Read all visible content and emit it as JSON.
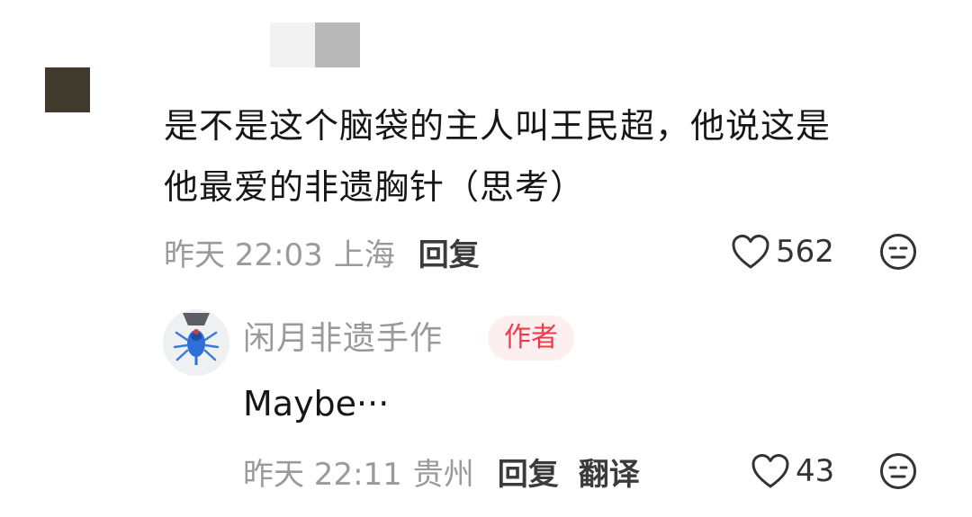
{
  "main_comment": {
    "line1": "是不是这个脑袋的主人叫王民超，他说这是",
    "line2": "他最爱的非遗胸针（思考）",
    "meta": {
      "time": "昨天 22:03",
      "location": "上海",
      "reply_label": "回复"
    },
    "likes": "562"
  },
  "reply": {
    "author": "闲月非遗手作",
    "author_tag": "作者",
    "text": "Maybe···",
    "meta": {
      "time": "昨天 22:11",
      "location": "贵州",
      "reply_label": "回复",
      "translate_label": "翻译"
    },
    "likes": "43"
  },
  "icons": {
    "like": "heart-outline-icon",
    "emoji": "neutral-face-icon"
  },
  "colors": {
    "author_tag_text": "#f03a4a",
    "author_tag_bg": "#fdeeef",
    "meta_text": "#9a9a9a"
  }
}
